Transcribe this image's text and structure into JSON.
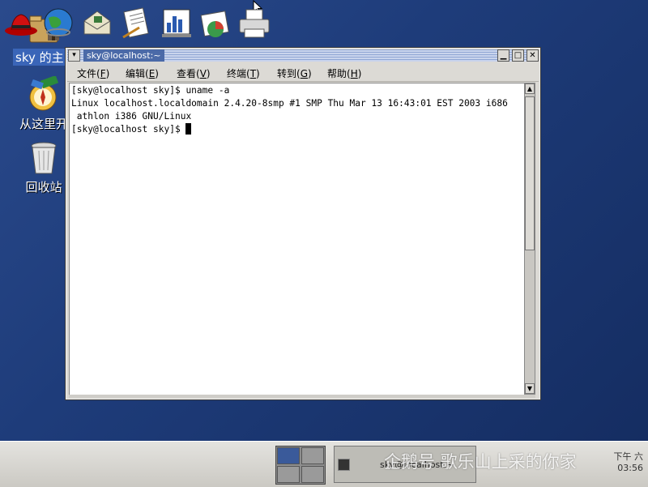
{
  "desktop": {
    "icons": [
      {
        "label": "sky 的主目"
      },
      {
        "label": "从这里开"
      },
      {
        "label": "回收站"
      }
    ]
  },
  "window": {
    "title": "sky@localhost:~",
    "menu_button": "▾",
    "minimize": "▁",
    "maximize": "□",
    "close": "✕",
    "menu": [
      {
        "label": "文件(",
        "key": "F",
        "end": ")"
      },
      {
        "label": "编辑(",
        "key": "E",
        "end": ")"
      },
      {
        "label": "查看(",
        "key": "V",
        "end": ")"
      },
      {
        "label": "终端(",
        "key": "T",
        "end": ")"
      },
      {
        "label": "转到(",
        "key": "G",
        "end": ")"
      },
      {
        "label": "帮助(",
        "key": "H",
        "end": ")"
      }
    ]
  },
  "terminal": {
    "lines": [
      "[sky@localhost sky]$ uname -a",
      "Linux localhost.localdomain 2.4.20-8smp #1 SMP Thu Mar 13 16:43:01 EST 2003 i686",
      " athlon i386 GNU/Linux",
      "[sky@localhost sky]$ "
    ]
  },
  "panel": {
    "task_label": "sky@localhost:~",
    "clock_line1": "下午 六",
    "clock_line2": "03:56",
    "colors": {
      "panel": "#d8d6d0",
      "desktop": "#1e3c7a"
    }
  },
  "watermark": "企鹅号 歌乐山上采的你家"
}
